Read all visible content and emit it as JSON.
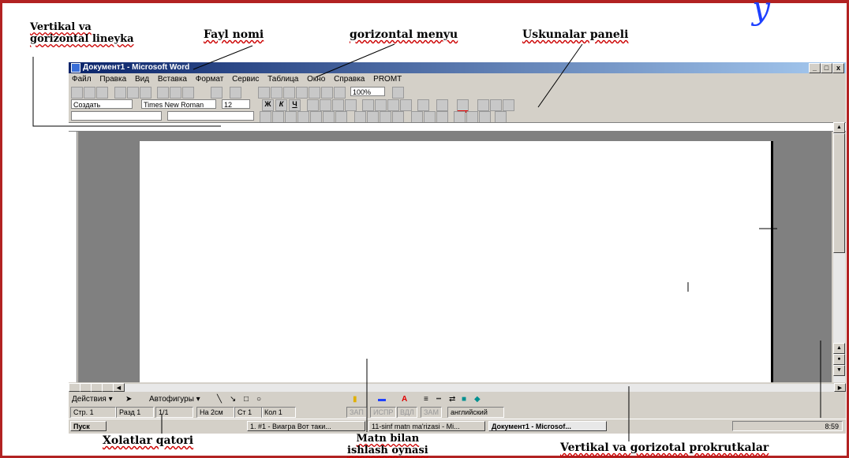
{
  "annotations": {
    "rulers": "Vertikal va\ngorizontal lineyka",
    "filename": "Fayl nomi",
    "menu": "gorizontal menyu",
    "toolbars": "Uskunalar paneli",
    "statusbar": "Xolatlar qatori",
    "workarea": "Matn bilan\nishlash oynasi",
    "scrollbars": "Vertikal va gorizotal prokrutkalar"
  },
  "window": {
    "title": "Документ1 - Microsoft Word",
    "controls": [
      "_",
      "□",
      "x"
    ]
  },
  "menu": [
    "Файл",
    "Правка",
    "Вид",
    "Вставка",
    "Формат",
    "Сервис",
    "Таблица",
    "Окно",
    "Справка",
    "PROMT"
  ],
  "toolbar": {
    "zoom": "100%",
    "style_tooltip": "Создать",
    "font": "Times New Roman",
    "size": "12",
    "bold": "Ж",
    "italic": "К",
    "underline": "Ч"
  },
  "drawbar": {
    "actions": "Действия ▾",
    "autoshapes": "Автофигуры ▾"
  },
  "status": {
    "page": "Стр. 1",
    "section": "Разд 1",
    "pages": "1/1",
    "at": "На 2см",
    "line": "Ст 1",
    "col": "Кол 1",
    "rec": "ЗАП",
    "trk": "ИСПР",
    "ext": "ВДЛ",
    "ovr": "ЗАМ",
    "lang": "английский"
  },
  "taskbar": {
    "start": "Пуск",
    "tasks": [
      "1. #1 - Виагра Вот таки...",
      "11-sinf matn ma'rizasi - Mi...",
      "Документ1 - Microsof..."
    ],
    "clock": "8:59"
  }
}
